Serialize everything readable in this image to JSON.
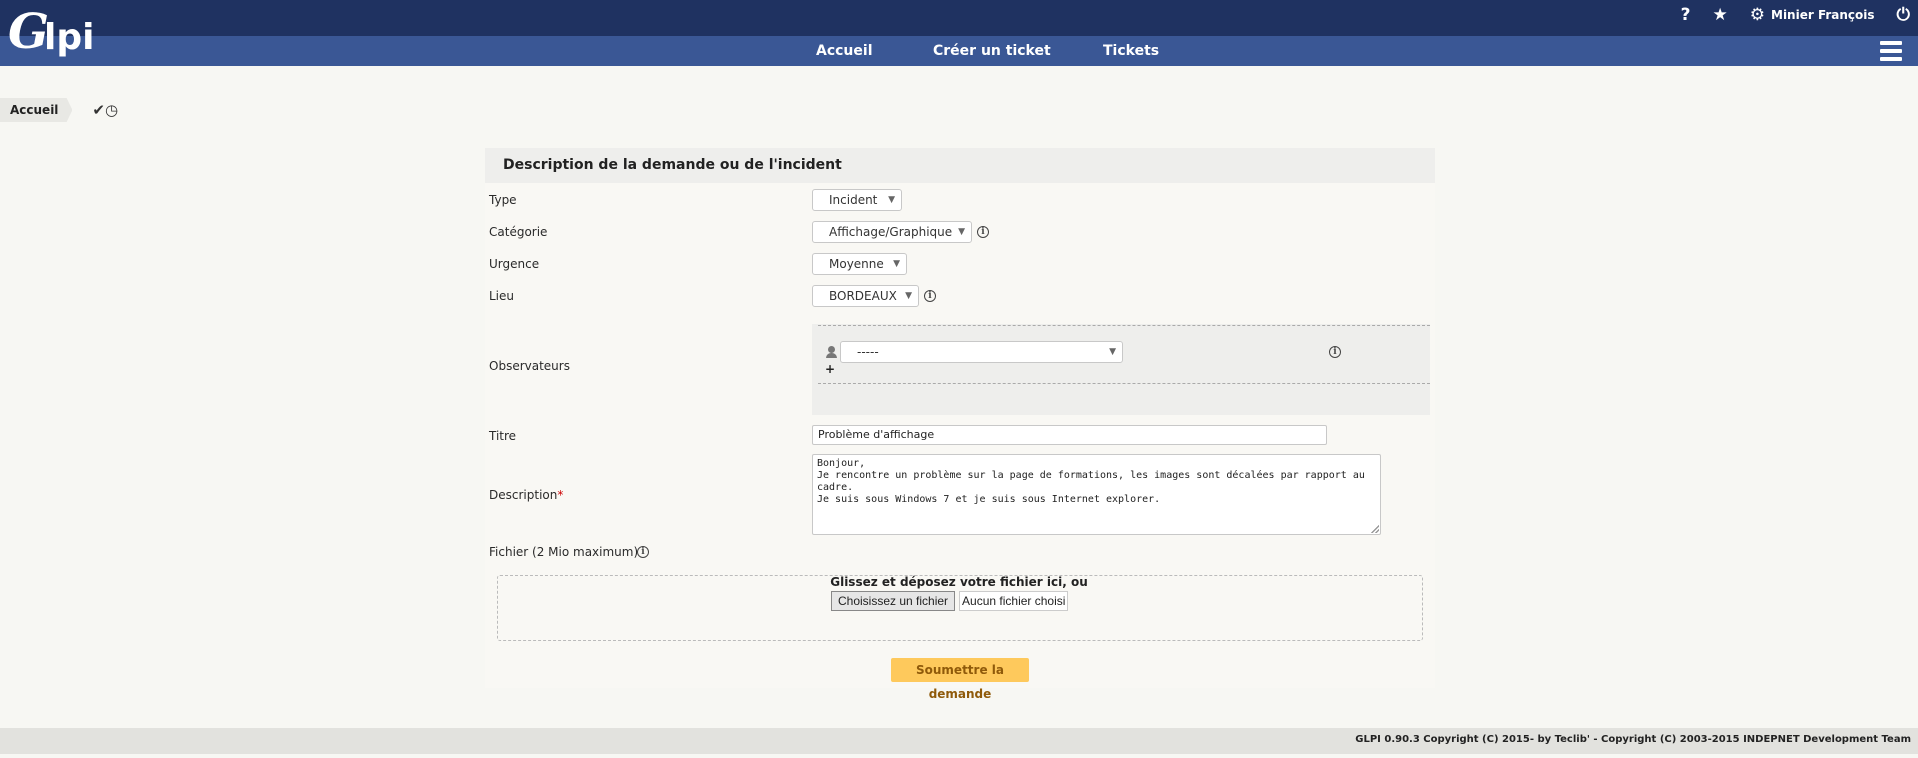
{
  "header": {
    "logo_text": "Glpi",
    "user_name": "Minier François",
    "icons": [
      "help-icon",
      "star-icon",
      "gear-icon",
      "power-icon"
    ]
  },
  "nav": {
    "home": "Accueil",
    "create_ticket": "Créer un ticket",
    "tickets": "Tickets"
  },
  "breadcrumb": {
    "label": "Accueil",
    "icon": "check-clock-icon"
  },
  "form": {
    "title": "Description de la demande ou de l'incident",
    "type": {
      "label": "Type",
      "value": "Incident"
    },
    "category": {
      "label": "Catégorie",
      "value": "Affichage/Graphique"
    },
    "urgency": {
      "label": "Urgence",
      "value": "Moyenne"
    },
    "location": {
      "label": "Lieu",
      "value": "BORDEAUX"
    },
    "observers": {
      "label": "Observateurs",
      "value": "-----",
      "add": "+"
    },
    "title_field": {
      "label": "Titre",
      "value": "Problème d'affichage"
    },
    "description": {
      "label": "Description",
      "required_mark": "*",
      "value": "Bonjour,\nJe rencontre un problème sur la page de formations, les images sont décalées par rapport au cadre.\nJe suis sous Windows 7 et je suis sous Internet explorer."
    },
    "file": {
      "label": "Fichier (2 Mio maximum)",
      "drop_text": "Glissez et déposez votre fichier ici, ou",
      "button": "Choisissez un fichier",
      "status": "Aucun fichier choisi"
    },
    "submit": "Soumettre la demande"
  },
  "footer": {
    "text": "GLPI 0.90.3 Copyright (C) 2015- by Teclib' - Copyright (C) 2003-2015 INDEPNET Development Team"
  },
  "colors": {
    "topbar": "#1f3261",
    "navbar": "#3a5795",
    "submit_bg": "#fec95c",
    "page_bg": "#f7f7f3"
  }
}
